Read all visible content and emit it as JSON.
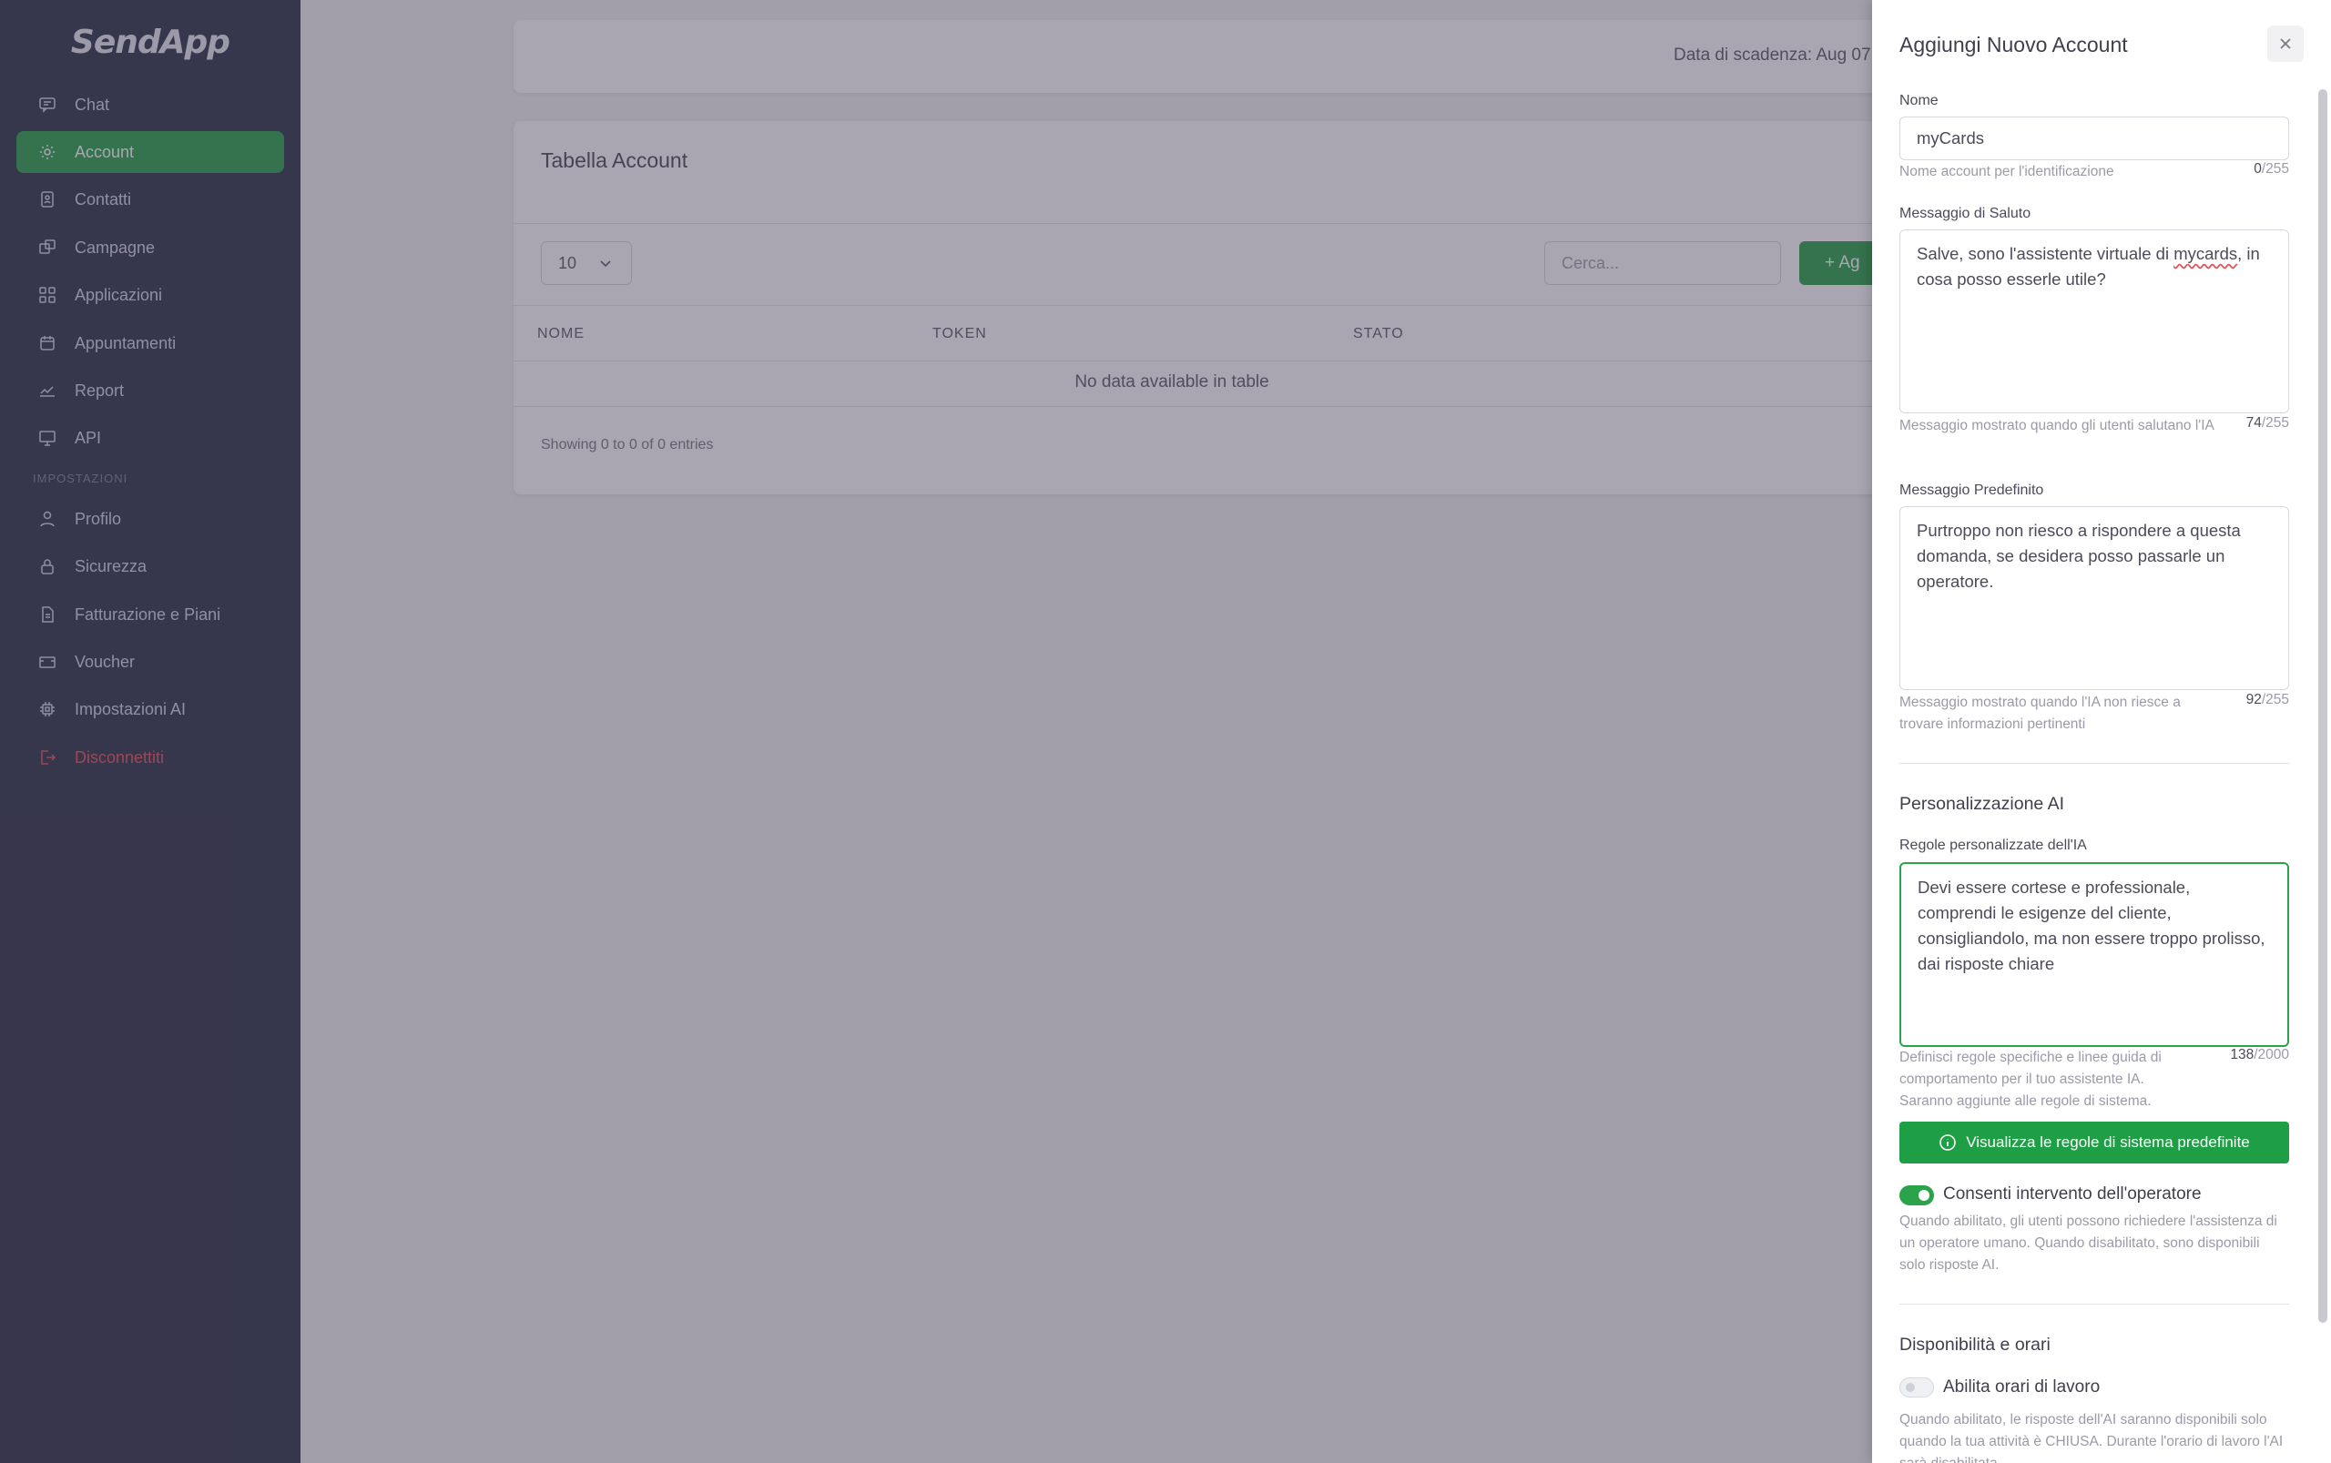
{
  "sidebar": {
    "logo": "SendApp",
    "items": [
      {
        "label": "Chat",
        "icon": "chat-icon"
      },
      {
        "label": "Account",
        "icon": "gear-icon",
        "active": true
      },
      {
        "label": "Contatti",
        "icon": "contacts-icon"
      },
      {
        "label": "Campagne",
        "icon": "campaign-icon"
      },
      {
        "label": "Applicazioni",
        "icon": "apps-icon"
      },
      {
        "label": "Appuntamenti",
        "icon": "calendar-icon"
      },
      {
        "label": "Report",
        "icon": "chart-icon"
      },
      {
        "label": "API",
        "icon": "monitor-icon"
      }
    ],
    "section_label": "IMPOSTAZIONI",
    "settings_items": [
      {
        "label": "Profilo",
        "icon": "user-icon"
      },
      {
        "label": "Sicurezza",
        "icon": "lock-icon"
      },
      {
        "label": "Fatturazione e Piani",
        "icon": "file-icon"
      },
      {
        "label": "Voucher",
        "icon": "ticket-icon"
      },
      {
        "label": "Impostazioni AI",
        "icon": "cpu-icon"
      },
      {
        "label": "Disconnettiti",
        "icon": "logout-icon"
      }
    ]
  },
  "topbar": {
    "expiry": "Data di scadenza: Aug 07"
  },
  "table_card": {
    "title": "Tabella Account",
    "page_length": "10",
    "search_placeholder": "Cerca...",
    "add_button": "+ Ag",
    "columns": [
      "NOME",
      "TOKEN",
      "STATO"
    ],
    "empty_message": "No data available in table",
    "info": "Showing 0 to 0 of 0 entries"
  },
  "drawer": {
    "title": "Aggiungi Nuovo Account",
    "name": {
      "label": "Nome",
      "value": "myCards",
      "hint": "Nome account per l'identificazione",
      "count": "0",
      "max": "/255"
    },
    "greeting": {
      "label": "Messaggio di Saluto",
      "value_before": "Salve, sono l'assistente virtuale di ",
      "value_underlined": "mycards",
      "value_after": ", in cosa posso esserle utile?",
      "hint": "Messaggio mostrato quando gli utenti salutano l'IA",
      "count": "74",
      "max": "/255"
    },
    "default_message": {
      "label": "Messaggio Predefinito",
      "value": "Purtroppo non riesco a rispondere a questa domanda, se desidera posso passarle un operatore.",
      "hint": "Messaggio mostrato quando l'IA non riesce a trovare informazioni pertinenti",
      "count": "92",
      "max": "/255"
    },
    "ai_section_title": "Personalizzazione AI",
    "rules": {
      "label": "Regole personalizzate dell'IA",
      "value": "Devi essere cortese e professionale, comprendi le esigenze del cliente, consigliandolo, ma non essere troppo prolisso, dai risposte chiare",
      "hint": "Definisci regole specifiche e linee guida di comportamento per il tuo assistente IA. Saranno aggiunte alle regole di sistema.",
      "count": "138",
      "max": "/2000"
    },
    "view_rules_button": "Visualizza le regole di sistema predefinite",
    "operator": {
      "label": "Consenti intervento dell'operatore",
      "enabled": true,
      "hint": "Quando abilitato, gli utenti possono richiedere l'assistenza di un operatore umano. Quando disabilitato, sono disponibili solo risposte AI."
    },
    "availability_title": "Disponibilità e orari",
    "work_hours": {
      "label": "Abilita orari di lavoro",
      "enabled": false,
      "hint": "Quando abilitato, le risposte dell'AI saranno disponibili solo quando la tua attività è CHIUSA. Durante l'orario di lavoro l'AI sarà disabilitata."
    }
  },
  "colors": {
    "accent": "#2aa34a",
    "sidebar_bg": "#2f3349",
    "danger": "#ea5455"
  }
}
